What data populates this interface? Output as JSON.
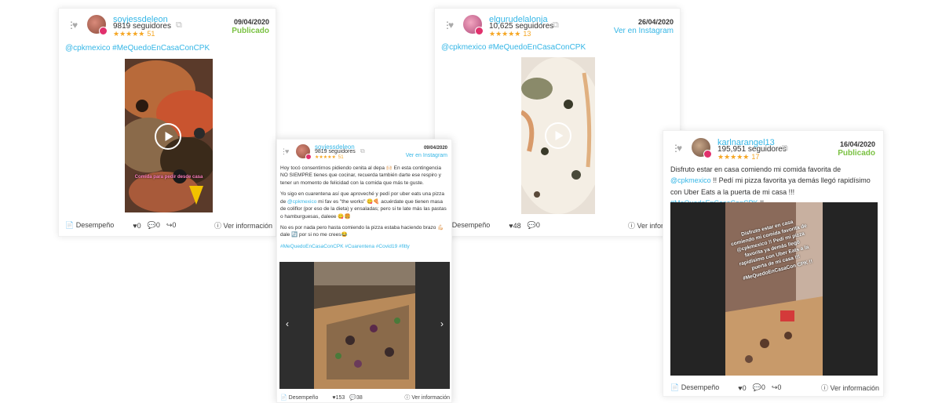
{
  "cards": [
    {
      "username": "soyjessdeleon",
      "followers": "9819 seguidores",
      "stars": "★★★★★",
      "rating_count": "51",
      "date": "09/04/2020",
      "status": "Publicado",
      "hashtags": "@cpkmexico #MeQuedoEnCasaConCPK",
      "overlay": "Comida para pedir desde casa",
      "footer": {
        "performance": "Desempeño",
        "likes": "0",
        "comments": "0",
        "shares": "0",
        "more_info": "Ver información"
      }
    },
    {
      "username": "soyjessdeleon",
      "followers": "9819 seguidores",
      "stars": "★★★★★",
      "rating_count": "51",
      "date": "09/04/2020",
      "status": "Ver en Instagram",
      "body": {
        "p1": "Hoy tocó consentirnos pidiendo cenita al depa 🙌🏻 En esta contingencia NO SIEMPRE tienes que cocinar, recuerda también darte ese respiro y tener un momento de felicidad con la comida que más te guste.",
        "p2a": "Yo sigo en cuarentena así que aproveché y pedí por uber eats una pizza de",
        "p2link": "@cpkmexico",
        "p2b": "mi fav es \"the works\" 😋🍕 acuérdate que tienen masa de coliflor (por eso de la dieta) y ensaladas; pero si te late más las pastas o hamburguesas, daleee 😋🍔",
        "p3": "No es por nada pero hasta comiendo la pizza estaba haciendo brazo 💪🏻 dale 🔄 por si no me crees😂",
        "tags": "#MeQuedoEnCasaConCPK #Cuarentena #Covid19 #fitty"
      },
      "footer": {
        "performance": "Desempeño",
        "likes": "153",
        "comments": "38",
        "more_info": "Ver información"
      }
    },
    {
      "username": "elgurudelalonja",
      "followers": "10,625 seguidores",
      "stars": "★★★★★",
      "rating_count": "13",
      "date": "26/04/2020",
      "status": "Ver en Instagram",
      "hashtags": "@cpkmexico #MeQuedoEnCasaConCPK",
      "footer": {
        "performance": "Desempeño",
        "likes": "48",
        "comments": "0",
        "more_info": "Ver informac"
      }
    },
    {
      "username": "karlnarangel13",
      "followers": "195,951 seguidores",
      "stars": "★★★★★",
      "rating_count": "17",
      "date": "16/04/2020",
      "status": "Publicado",
      "caption": {
        "a": "Disfruto estar en casa comiendo mi comida favorita de",
        "link1": "@cpkmexico",
        "b": "!! Pedí mi pizza favorita ya demás llegó rapidísimo con Uber Eats a la puerta de mi casa !!!",
        "link2": "#MeQuedoEnCasaConCPK",
        "c": "!!"
      },
      "overlay": "Disfruto estar en casa comiendo mi comida favorita de @cpkmexico !! Pedí mi pizza favorita ya demás llegó rapidísimo con Uber Eats a la puerta de mi casa !!! #MeQuedoEnCasaCon CPK !!",
      "footer": {
        "performance": "Desempeño",
        "likes": "0",
        "comments": "0",
        "shares": "0",
        "more_info": "Ver información"
      }
    }
  ],
  "colors": {
    "accent": "#35b6e6",
    "published": "#7ac142",
    "stars": "#f5a623"
  }
}
